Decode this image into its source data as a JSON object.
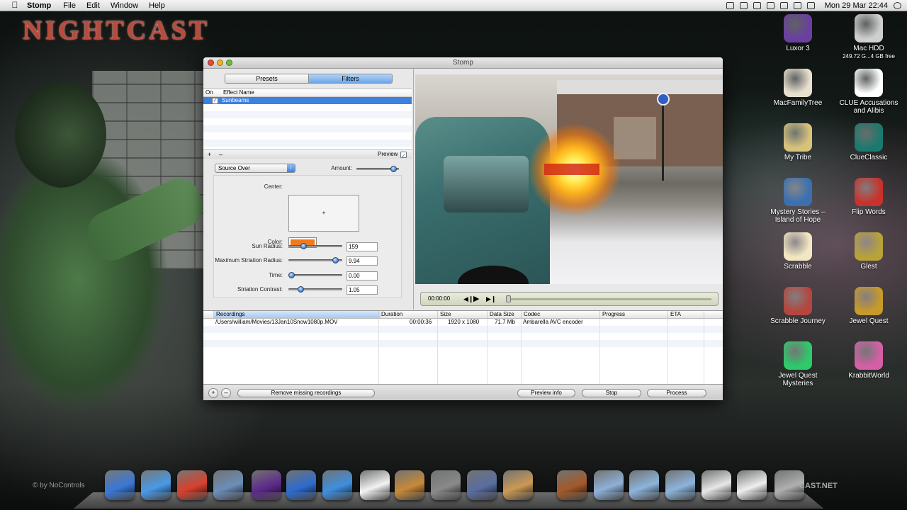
{
  "menubar": {
    "app": "Stomp",
    "items": [
      "File",
      "Edit",
      "Window",
      "Help"
    ],
    "clock": "Mon 29 Mar  22:44"
  },
  "desktop": {
    "wallpaper_title": "NIGHTCAST",
    "copyright": "© by NoControls",
    "site_suffix": "CAST.NET",
    "icons": [
      {
        "label": "Luxor 3",
        "sub": "",
        "icon": "luxor-icon",
        "color": "#6a3fa0"
      },
      {
        "label": "Mac HDD",
        "sub": "249.72 G...4 GB free",
        "icon": "hard-drive-icon",
        "color": "#cfcfcf"
      },
      {
        "label": "MacFamilyTree",
        "sub": "",
        "icon": "family-tree-icon",
        "color": "#e8e0cf"
      },
      {
        "label": "CLUE Accusations and Alibis",
        "sub": "",
        "icon": "question-mark-icon",
        "color": "#ffffff"
      },
      {
        "label": "My Tribe",
        "sub": "",
        "icon": "my-tribe-icon",
        "color": "#d8c27a"
      },
      {
        "label": "ClueClassic",
        "sub": "",
        "icon": "clue-classic-icon",
        "color": "#1b7a6d"
      },
      {
        "label": "Mystery Stories – Island of Hope",
        "sub": "",
        "icon": "palm-tree-icon",
        "color": "#3a6fb0"
      },
      {
        "label": "Flip Words",
        "sub": "",
        "icon": "flip-words-icon",
        "color": "#c8322c"
      },
      {
        "label": "Scrabble",
        "sub": "",
        "icon": "scrabble-tile-icon",
        "color": "#f3e7c3"
      },
      {
        "label": "Glest",
        "sub": "",
        "icon": "glest-icon",
        "color": "#b8a23a"
      },
      {
        "label": "Scrabble Journey",
        "sub": "",
        "icon": "scrabble-journey-icon",
        "color": "#b4463e"
      },
      {
        "label": "Jewel Quest",
        "sub": "",
        "icon": "jewel-quest-icon",
        "color": "#c79a2b"
      },
      {
        "label": "Jewel Quest Mysteries",
        "sub": "",
        "icon": "green-gem-icon",
        "color": "#2ec96a"
      },
      {
        "label": "KrabbitWorld",
        "sub": "",
        "icon": "krabbit-icon",
        "color": "#d45fa6"
      }
    ]
  },
  "window": {
    "title": "Stomp",
    "segments": [
      "Presets",
      "Filters"
    ],
    "effects_header": {
      "on": "On",
      "name": "Effect Name"
    },
    "effects": [
      {
        "name": "Sunbeams",
        "on": true
      }
    ],
    "add_symbol": "+",
    "remove_symbol": "–",
    "preview_label": "Preview",
    "blend_mode": "Source Over",
    "amount_label": "Amount:",
    "center_label": "Center:",
    "center_marker": "+",
    "color_label": "Color:",
    "color_value": "#f07a1c",
    "params": [
      {
        "label": "Sun Radius:",
        "value": "159",
        "level": 0.25
      },
      {
        "label": "Maximum Striation Radius:",
        "value": "9.94",
        "level": 0.92
      },
      {
        "label": "Time:",
        "value": "0.00",
        "level": 0.0
      },
      {
        "label": "Striation Contrast:",
        "value": "1.05",
        "level": 0.2
      }
    ],
    "amount_level": 0.95,
    "player": {
      "time": "00:00:00",
      "position": 0.0
    },
    "table": {
      "columns": [
        "Recordings",
        "Duration",
        "Size",
        "Data Size",
        "Codec",
        "Progress",
        "ETA"
      ],
      "rows": [
        {
          "recording": "/Users/william/Movies/13Jan10Snow1080p.MOV",
          "duration": "00:00:36",
          "size": "1920 x 1080",
          "data_size": "71.7 Mb",
          "codec": "Ambarella AVC encoder",
          "progress": "",
          "eta": ""
        }
      ]
    },
    "bottom": {
      "add": "+",
      "remove": "–",
      "remove_missing": "Remove missing recordings",
      "preview_info": "Preview info",
      "stop": "Stop",
      "process": "Process"
    }
  },
  "dock": {
    "items": [
      {
        "name": "finder-icon",
        "color": "#3a78d8"
      },
      {
        "name": "safari-compass-icon",
        "color": "#4a9ae8"
      },
      {
        "name": "chrome-icon",
        "color": "#d9412f"
      },
      {
        "name": "preview-bird-icon",
        "color": "#6c8fb8"
      },
      {
        "name": "purple-app-icon",
        "color": "#5d2a8c"
      },
      {
        "name": "quicktime-icon",
        "color": "#2d6ccf"
      },
      {
        "name": "m-app-icon",
        "color": "#3f8fe0"
      },
      {
        "name": "quote-app-icon",
        "color": "#f4f4f4"
      },
      {
        "name": "pen-notebook-icon",
        "color": "#c88a3a"
      },
      {
        "name": "system-preferences-icon",
        "color": "#8a8a8a"
      },
      {
        "name": "final-cut-icon",
        "color": "#5a6ea0"
      },
      {
        "name": "photo-slideshow-icon",
        "color": "#cc9a55"
      },
      {
        "name": "bookshelf-icon",
        "color": "#a35a2a"
      },
      {
        "name": "database-icon",
        "color": "#8fb1d8"
      },
      {
        "name": "folder-icon",
        "color": "#8db5dc"
      },
      {
        "name": "folder-icon",
        "color": "#8db5dc"
      },
      {
        "name": "document-stack-icon",
        "color": "#e8e8e8"
      },
      {
        "name": "letter-icon",
        "color": "#f0f0f0"
      },
      {
        "name": "trash-icon",
        "color": "#b0b0b0"
      }
    ]
  }
}
